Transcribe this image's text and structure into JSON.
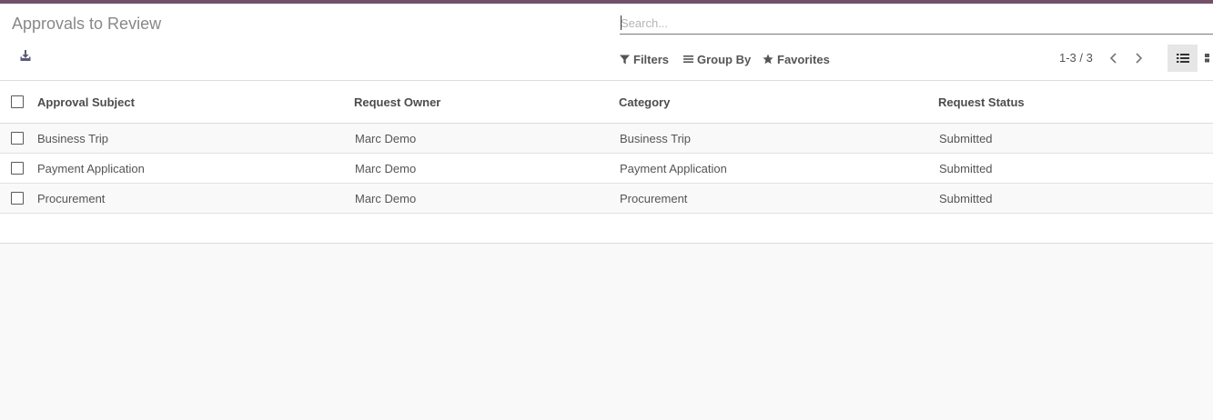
{
  "page": {
    "title": "Approvals to Review"
  },
  "search": {
    "placeholder": "Search..."
  },
  "toolbar": {
    "filters_label": "Filters",
    "group_by_label": "Group By",
    "favorites_label": "Favorites"
  },
  "pager": {
    "value": "1-3 / 3"
  },
  "table": {
    "columns": [
      "Approval Subject",
      "Request Owner",
      "Category",
      "Request Status"
    ],
    "rows": [
      [
        "Business Trip",
        "Marc Demo",
        "Business Trip",
        "Submitted"
      ],
      [
        "Payment Application",
        "Marc Demo",
        "Payment Application",
        "Submitted"
      ],
      [
        "Procurement",
        "Marc Demo",
        "Procurement",
        "Submitted"
      ]
    ]
  },
  "colors": {
    "topbar": "#71506a",
    "active_view_bg": "#e6e6e6"
  }
}
